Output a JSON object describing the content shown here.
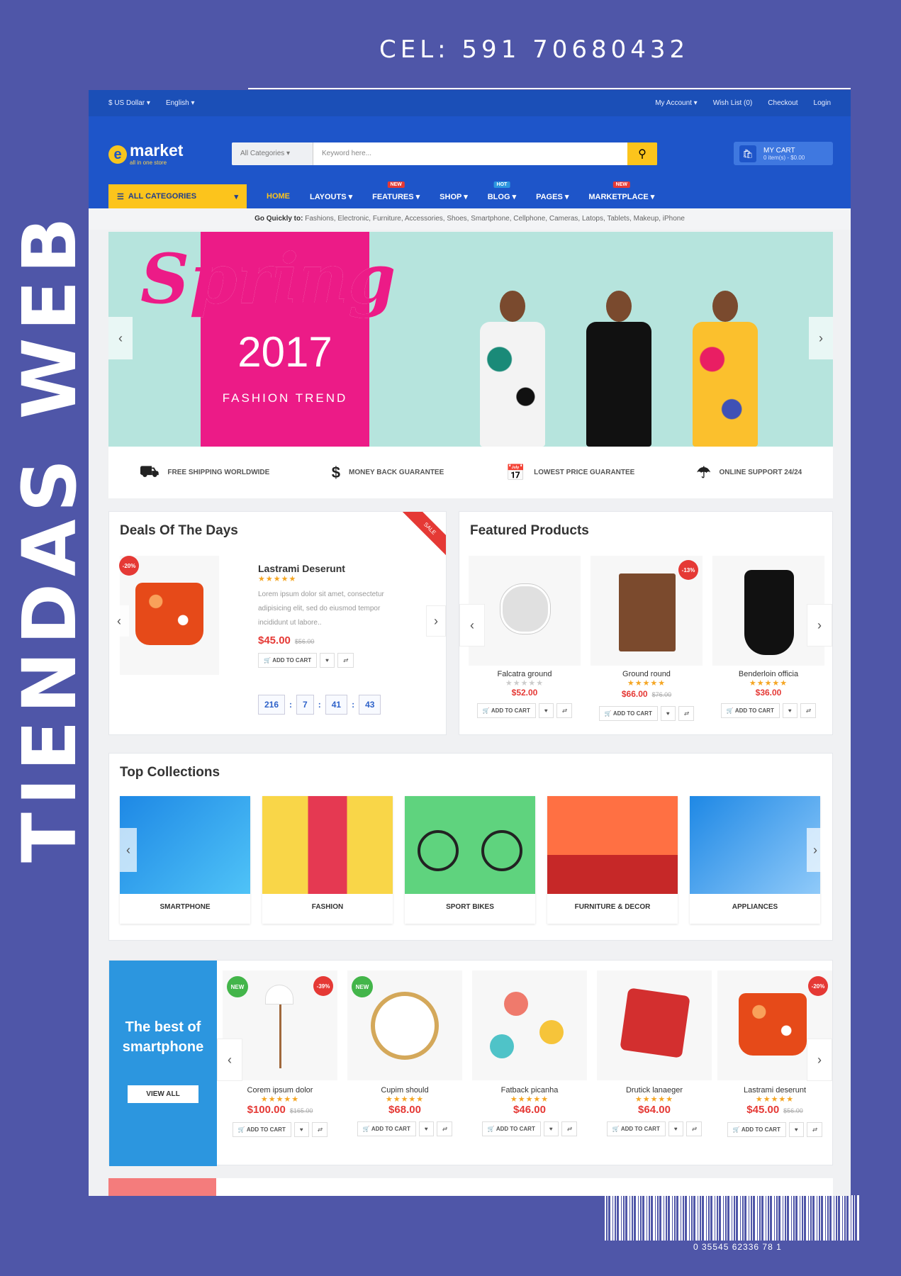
{
  "poster": {
    "phone": "CEL: 591 70680432",
    "vertical_title": "TIENDAS WEB",
    "barcode_number": "0 35545 62336 78 1"
  },
  "topbar": {
    "currency": "$ US Dollar ▾",
    "language": "English ▾",
    "my_account": "My Account ▾",
    "wish_list": "Wish List (0)",
    "checkout": "Checkout",
    "login": "Login"
  },
  "header": {
    "logo_word": "market",
    "logo_tagline": "all in one store",
    "search_category": "All Categories ▾",
    "search_placeholder": "Keyword here...",
    "cart_title": "MY CART",
    "cart_sub": "0 item(s) - $0.00"
  },
  "nav": {
    "all_categories": "ALL CATEGORIES",
    "items": [
      {
        "label": "HOME",
        "badge": ""
      },
      {
        "label": "LAYOUTS ▾",
        "badge": ""
      },
      {
        "label": "FEATURES ▾",
        "badge": "NEW",
        "badge_color": "#e53935"
      },
      {
        "label": "SHOP ▾",
        "badge": ""
      },
      {
        "label": "BLOG ▾",
        "badge": "HOT",
        "badge_color": "#2c96df"
      },
      {
        "label": "PAGES ▾",
        "badge": ""
      },
      {
        "label": "MARKETPLACE ▾",
        "badge": "NEW",
        "badge_color": "#e53935"
      }
    ]
  },
  "quick": {
    "label": "Go Quickly to:",
    "links": "Fashions,  Electronic,  Furniture,  Accessories,  Shoes,  Smartphone,  Cellphone,  Cameras,  Latops,  Tablets,  Makeup,  iPhone"
  },
  "hero": {
    "script": "Spring",
    "year": "2017",
    "tagline": "FASHION TREND"
  },
  "services": [
    {
      "icon": "truck-icon",
      "label": "FREE SHIPPING WORLDWIDE"
    },
    {
      "icon": "dollar-icon",
      "label": "MONEY BACK GUARANTEE"
    },
    {
      "icon": "calendar-icon",
      "label": "LOWEST PRICE GUARANTEE"
    },
    {
      "icon": "umbrella-icon",
      "label": "ONLINE SUPPORT 24/24"
    }
  ],
  "deals": {
    "title": "Deals Of The Days",
    "ribbon": "SALE",
    "discount": "-20%",
    "product_name": "Lastrami Deserunt",
    "stars": "★★★★★",
    "description": "Lorem ipsum dolor sit amet, consectetur adipisicing elit, sed do eiusmod tempor incididunt ut labore..",
    "price": "$45.00",
    "old_price": "$56.00",
    "add_to_cart": "ADD TO CART",
    "timer": [
      "216",
      "7",
      "41",
      "43"
    ]
  },
  "featured": {
    "title": "Featured Products",
    "products": [
      {
        "name": "Falcatra ground",
        "stars": "★★★★★",
        "price": "$52.00",
        "old": "",
        "badge": ""
      },
      {
        "name": "Ground round",
        "stars": "★★★★★",
        "price": "$66.00",
        "old": "$76.00",
        "badge": "-13%"
      },
      {
        "name": "Benderloin officia",
        "stars": "★★★★★",
        "price": "$36.00",
        "old": "",
        "badge": ""
      }
    ],
    "add_to_cart": "ADD TO CART"
  },
  "collections": {
    "title": "Top Collections",
    "items": [
      "SMARTPHONE",
      "FASHION",
      "SPORT BIKES",
      "FURNITURE & DECOR",
      "APPLIANCES"
    ]
  },
  "bestphone": {
    "title": "The best of smartphone",
    "view_all": "VIEW ALL",
    "products": [
      {
        "name": "Corem ipsum dolor",
        "stars": "★★★★★",
        "price": "$100.00",
        "old": "$165.00",
        "new": "NEW",
        "disc": "-39%"
      },
      {
        "name": "Cupim should",
        "stars": "★★★★★",
        "price": "$68.00",
        "old": "",
        "new": "NEW",
        "disc": ""
      },
      {
        "name": "Fatback picanha",
        "stars": "★★★★★",
        "price": "$46.00",
        "old": "",
        "new": "",
        "disc": ""
      },
      {
        "name": "Drutick lanaeger",
        "stars": "★★★★★",
        "price": "$64.00",
        "old": "",
        "new": "",
        "disc": ""
      },
      {
        "name": "Lastrami deserunt",
        "stars": "★★★★★",
        "price": "$45.00",
        "old": "$56.00",
        "new": "",
        "disc": "-20%"
      }
    ],
    "add_to_cart": "ADD TO CART"
  }
}
